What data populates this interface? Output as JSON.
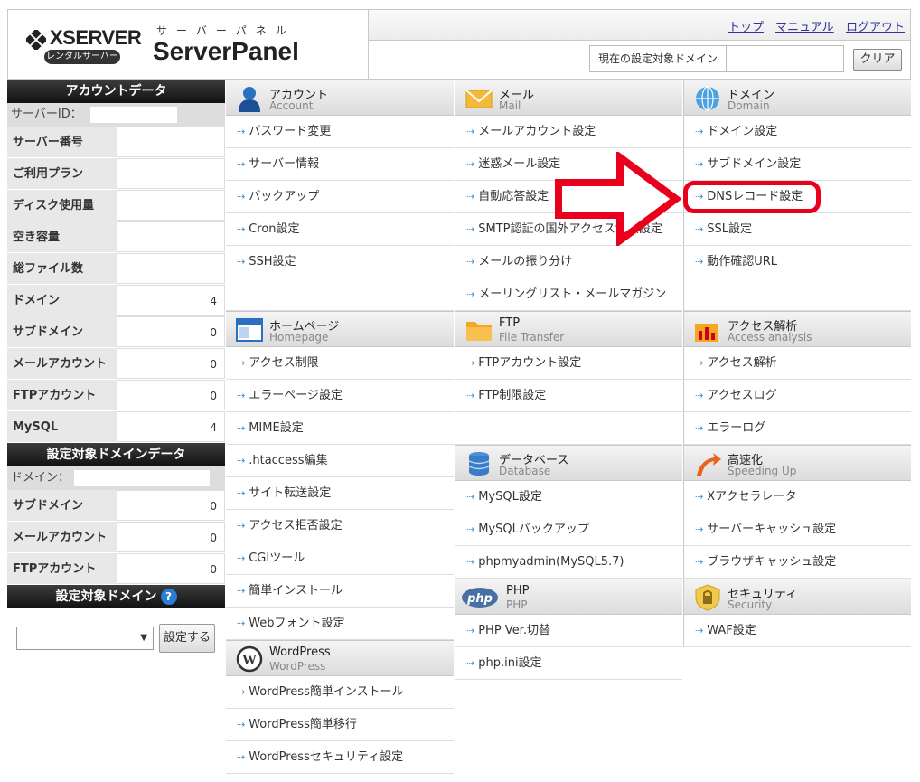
{
  "brand": {
    "logo": "XSERVER",
    "logo_sub": "レンタルサーバー",
    "kana": "サーバーパネル",
    "title": "ServerPanel"
  },
  "nav": {
    "top": "トップ",
    "manual": "マニュアル",
    "logout": "ログアウト"
  },
  "domain_bar": {
    "label": "現在の設定対象ドメイン",
    "value": "",
    "clear": "クリア"
  },
  "sidebar": {
    "account_title": "アカウントデータ",
    "server_id_label": "サーバーID：",
    "account_rows": [
      {
        "k": "サーバー番号",
        "v": ""
      },
      {
        "k": "ご利用プラン",
        "v": ""
      },
      {
        "k": "ディスク使用量",
        "v": ""
      },
      {
        "k": "空き容量",
        "v": ""
      },
      {
        "k": "総ファイル数",
        "v": ""
      },
      {
        "k": "ドメイン",
        "v": "4"
      },
      {
        "k": "サブドメイン",
        "v": "0"
      },
      {
        "k": "メールアカウント",
        "v": "0"
      },
      {
        "k": "FTPアカウント",
        "v": "0"
      },
      {
        "k": "MySQL",
        "v": "4"
      }
    ],
    "domain_title": "設定対象ドメインデータ",
    "domain_label": "ドメイン：",
    "domain_rows": [
      {
        "k": "サブドメイン",
        "v": "0"
      },
      {
        "k": "メールアカウント",
        "v": "0"
      },
      {
        "k": "FTPアカウント",
        "v": "0"
      }
    ],
    "target_title": "設定対象ドメイン",
    "help": "?",
    "select_value": "",
    "set_button": "設定する"
  },
  "sections": {
    "account": {
      "t1": "アカウント",
      "t2": "Account",
      "items": [
        "パスワード変更",
        "サーバー情報",
        "バックアップ",
        "Cron設定",
        "SSH設定"
      ]
    },
    "homepage": {
      "t1": "ホームページ",
      "t2": "Homepage",
      "items": [
        "アクセス制限",
        "エラーページ設定",
        "MIME設定",
        ".htaccess編集",
        "サイト転送設定",
        "アクセス拒否設定",
        "CGIツール",
        "簡単インストール",
        "Webフォント設定"
      ]
    },
    "wordpress": {
      "t1": "WordPress",
      "t2": "WordPress",
      "items": [
        "WordPress簡単インストール",
        "WordPress簡単移行",
        "WordPressセキュリティ設定"
      ]
    },
    "mail": {
      "t1": "メール",
      "t2": "Mail",
      "items": [
        "メールアカウント設定",
        "迷惑メール設定",
        "自動応答設定",
        "SMTP認証の国外アクセス制限設定",
        "メールの振り分け",
        "メーリングリスト・メールマガジン"
      ]
    },
    "ftp": {
      "t1": "FTP",
      "t2": "File Transfer",
      "items": [
        "FTPアカウント設定",
        "FTP制限設定"
      ]
    },
    "database": {
      "t1": "データベース",
      "t2": "Database",
      "items": [
        "MySQL設定",
        "MySQLバックアップ",
        "phpmyadmin(MySQL5.7)"
      ]
    },
    "php": {
      "t1": "PHP",
      "t2": "PHP",
      "logo": "php",
      "items": [
        "PHP Ver.切替",
        "php.ini設定"
      ]
    },
    "domain": {
      "t1": "ドメイン",
      "t2": "Domain",
      "items": [
        "ドメイン設定",
        "サブドメイン設定",
        "DNSレコード設定",
        "SSL設定",
        "動作確認URL"
      ]
    },
    "access": {
      "t1": "アクセス解析",
      "t2": "Access analysis",
      "items": [
        "アクセス解析",
        "アクセスログ",
        "エラーログ"
      ]
    },
    "speed": {
      "t1": "高速化",
      "t2": "Speeding Up",
      "items": [
        "Xアクセラレータ",
        "サーバーキャッシュ設定",
        "ブラウザキャッシュ設定"
      ]
    },
    "security": {
      "t1": "セキュリティ",
      "t2": "Security",
      "items": [
        "WAF設定"
      ]
    }
  },
  "colors": {
    "annotation": "#e8001d",
    "link": "#333399",
    "arrow_bullet": "#4a90c8"
  }
}
